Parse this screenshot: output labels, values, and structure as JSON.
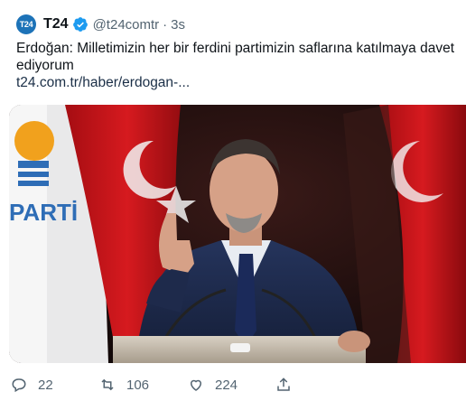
{
  "tweet": {
    "avatar_text": "T24",
    "display_name": "T24",
    "handle": "@t24comtr",
    "separator": "·",
    "time": "3s",
    "text_line1": "Erdoğan: Milletimizin her bir ferdini partimizin saflarına katılmaya davet",
    "text_line2": "ediyorum",
    "link": "t24.com.tr/haber/erdogan-...",
    "image_banner_text": "PARTİ",
    "actions": {
      "reply_count": "22",
      "retweet_count": "106",
      "like_count": "224"
    }
  },
  "colors": {
    "verified": "#1d9bf0",
    "avatar_bg": "#1d73b8",
    "secondary_text": "#536471"
  },
  "icons": [
    "verified-badge-icon",
    "reply-icon",
    "retweet-icon",
    "like-icon",
    "share-icon"
  ]
}
